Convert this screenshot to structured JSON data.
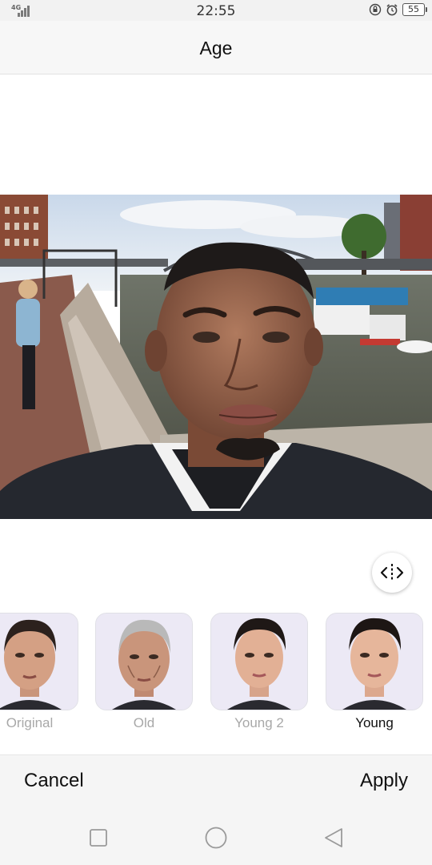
{
  "status_bar": {
    "network": "4G",
    "time": "22:55",
    "battery": "55",
    "icons": [
      "signal-icon",
      "lock-rotation-icon",
      "alarm-icon",
      "battery-icon"
    ]
  },
  "header": {
    "title": "Age"
  },
  "photo": {
    "description_icon": "selfie-photo"
  },
  "compare": {
    "icon": "compare-icon"
  },
  "filters": [
    {
      "label": "Original",
      "selected": false
    },
    {
      "label": "Old",
      "selected": false
    },
    {
      "label": "Young 2",
      "selected": false
    },
    {
      "label": "Young",
      "selected": true
    }
  ],
  "actions": {
    "cancel": "Cancel",
    "apply": "Apply"
  },
  "nav": {
    "icons": [
      "recents-icon",
      "home-icon",
      "back-icon"
    ]
  },
  "colors": {
    "accent": "#111111",
    "inactive_label": "#a8a8a8",
    "bar_bg": "#f5f5f5"
  }
}
